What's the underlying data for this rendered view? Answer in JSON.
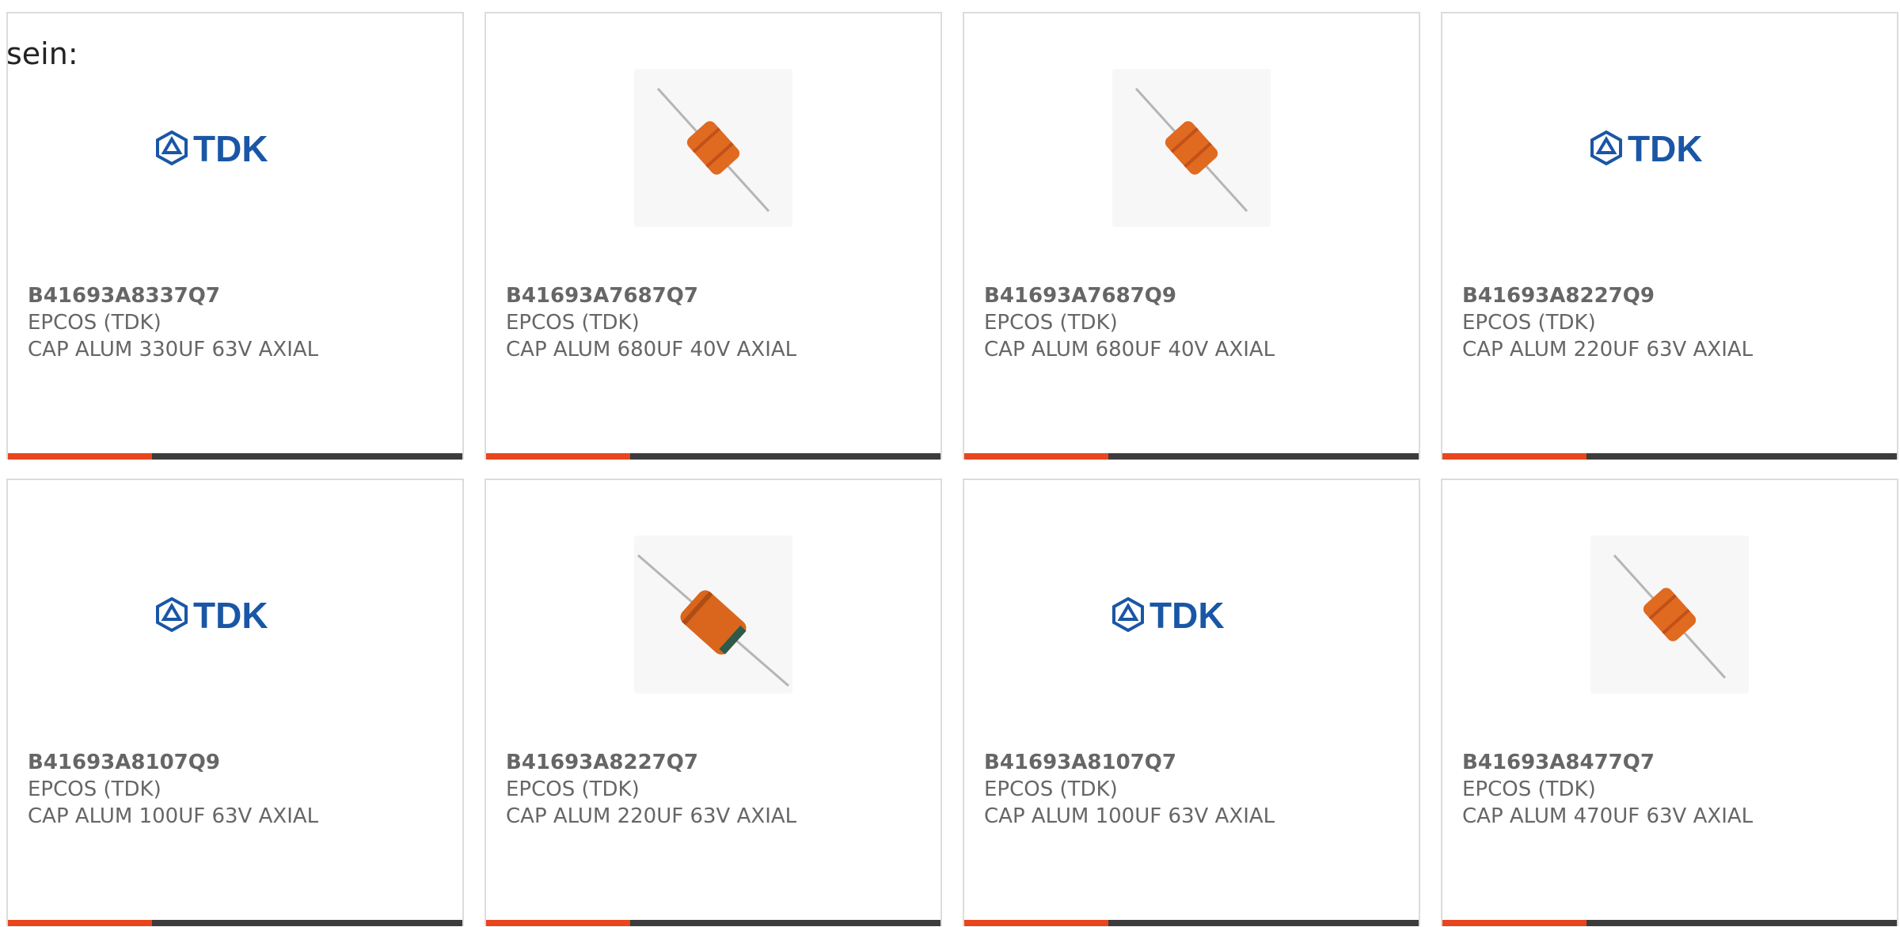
{
  "intro_text": "sein:",
  "colors": {
    "accent": "#e8461e",
    "bar": "#3c3c3c",
    "tdk_blue": "#1a56a6"
  },
  "cards": [
    {
      "part": "B41693A8337Q7",
      "maker": "EPCOS (TDK)",
      "desc": "CAP ALUM 330UF 63V AXIAL",
      "image": "tdk-logo",
      "logo_text": "TDK"
    },
    {
      "part": "B41693A7687Q7",
      "maker": "EPCOS (TDK)",
      "desc": "CAP ALUM 680UF 40V AXIAL",
      "image": "capacitor-photo"
    },
    {
      "part": "B41693A7687Q9",
      "maker": "EPCOS (TDK)",
      "desc": "CAP ALUM 680UF 40V AXIAL",
      "image": "capacitor-photo"
    },
    {
      "part": "B41693A8227Q9",
      "maker": "EPCOS (TDK)",
      "desc": "CAP ALUM 220UF 63V AXIAL",
      "image": "tdk-logo",
      "logo_text": "TDK"
    },
    {
      "part": "B41693A8107Q9",
      "maker": "EPCOS (TDK)",
      "desc": "CAP ALUM 100UF 63V AXIAL",
      "image": "tdk-logo",
      "logo_text": "TDK"
    },
    {
      "part": "B41693A8227Q7",
      "maker": "EPCOS (TDK)",
      "desc": "CAP ALUM 220UF 63V AXIAL",
      "image": "capacitor-photo"
    },
    {
      "part": "B41693A8107Q7",
      "maker": "EPCOS (TDK)",
      "desc": "CAP ALUM 100UF 63V AXIAL",
      "image": "tdk-logo",
      "logo_text": "TDK"
    },
    {
      "part": "B41693A8477Q7",
      "maker": "EPCOS (TDK)",
      "desc": "CAP ALUM 470UF 63V AXIAL",
      "image": "capacitor-photo"
    }
  ]
}
